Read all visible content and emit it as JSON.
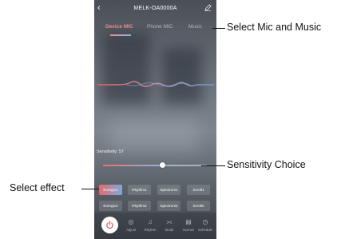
{
  "header": {
    "title": "MELK-OA0000A",
    "back_icon": "chevron-left-icon",
    "edit_icon": "pencil-icon"
  },
  "tabs": [
    {
      "label": "Device MIC",
      "active": true
    },
    {
      "label": "Phone MIC",
      "active": false
    },
    {
      "label": "Music",
      "active": false
    }
  ],
  "sensitivity": {
    "label": "Sensitivity: 57",
    "value": 57,
    "max": 100
  },
  "effects": [
    {
      "label": "Energic1",
      "selected": true
    },
    {
      "label": "Rhythm1",
      "selected": false
    },
    {
      "label": "Spectrum1",
      "selected": false
    },
    {
      "label": "Scroll1",
      "selected": false
    },
    {
      "label": "Energic2",
      "selected": false
    },
    {
      "label": "Rhythm2",
      "selected": false
    },
    {
      "label": "Spectrum2",
      "selected": false
    },
    {
      "label": "Scroll2",
      "selected": false
    }
  ],
  "bottom_nav": [
    {
      "label": "Adjust",
      "icon": "adjust-icon"
    },
    {
      "label": "Rhythm",
      "icon": "music-note-icon"
    },
    {
      "label": "Mode",
      "icon": "mode-icon"
    },
    {
      "label": "Scenes",
      "icon": "scenes-icon"
    },
    {
      "label": "Schedule",
      "icon": "clock-icon"
    }
  ],
  "annotations": {
    "mic_music": "Select Mic and Music",
    "sensitivity": "Sensitivity Choice",
    "effect": "Select effect"
  },
  "colors": {
    "accent_red": "#e46a6a",
    "accent_blue": "#7fa8db"
  }
}
